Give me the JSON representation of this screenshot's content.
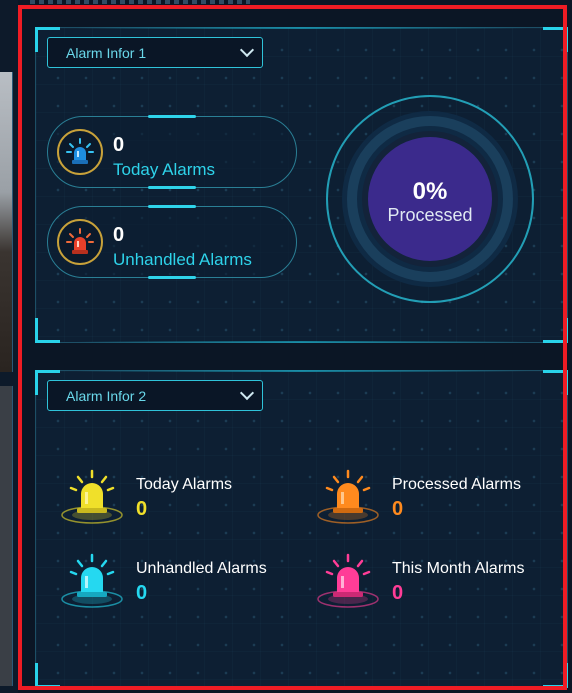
{
  "panel1": {
    "dropdown": {
      "selected": "Alarm Infor 1"
    },
    "today": {
      "value": "0",
      "label": "Today Alarms"
    },
    "unhandled": {
      "value": "0",
      "label": "Unhandled Alarms"
    },
    "gauge": {
      "percent": "0%",
      "label": "Processed",
      "fraction": 0
    }
  },
  "panel2": {
    "dropdown": {
      "selected": "Alarm Infor 2"
    },
    "stats": [
      {
        "label": "Today Alarms",
        "value": "0",
        "color": "#f0e02a",
        "icon": "yellow-alarm-light-icon"
      },
      {
        "label": "Processed Alarms",
        "value": "0",
        "color": "#ff8a1e",
        "icon": "orange-alarm-light-icon"
      },
      {
        "label": "Unhandled Alarms",
        "value": "0",
        "color": "#25d8f0",
        "icon": "cyan-alarm-light-icon"
      },
      {
        "label": "This Month Alarms",
        "value": "0",
        "color": "#ff3d97",
        "icon": "pink-alarm-light-icon"
      }
    ]
  },
  "colors": {
    "accent": "#2ed3ea",
    "frame_highlight": "#ee1c24",
    "gauge_fill": "#3b2a8c"
  }
}
